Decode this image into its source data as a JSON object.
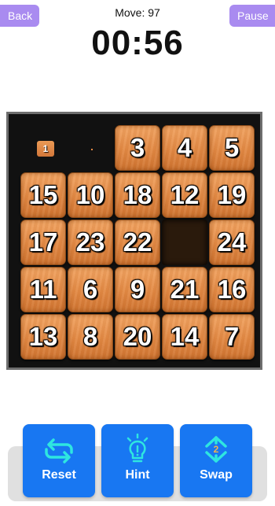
{
  "header": {
    "back_label": "Back",
    "pause_label": "Pause",
    "moves_text": "Move: 97",
    "timer": "00:56"
  },
  "board": {
    "size": 5,
    "tiles": [
      [
        1,
        null,
        3,
        4,
        5
      ],
      [
        15,
        10,
        18,
        12,
        19
      ],
      [
        17,
        23,
        22,
        0,
        24
      ],
      [
        11,
        6,
        9,
        21,
        16
      ],
      [
        13,
        8,
        20,
        14,
        7
      ]
    ],
    "tile_color": "#e38a45",
    "board_color": "#111111",
    "empty_color": "#2a1a0c"
  },
  "toolbar": {
    "reset_label": "Reset",
    "hint_label": "Hint",
    "swap_label": "Swap",
    "swap_count": "2",
    "button_color": "#1877f2",
    "icon_color": "#2ee6e0"
  },
  "colors": {
    "top_button": "#a98bf0"
  }
}
